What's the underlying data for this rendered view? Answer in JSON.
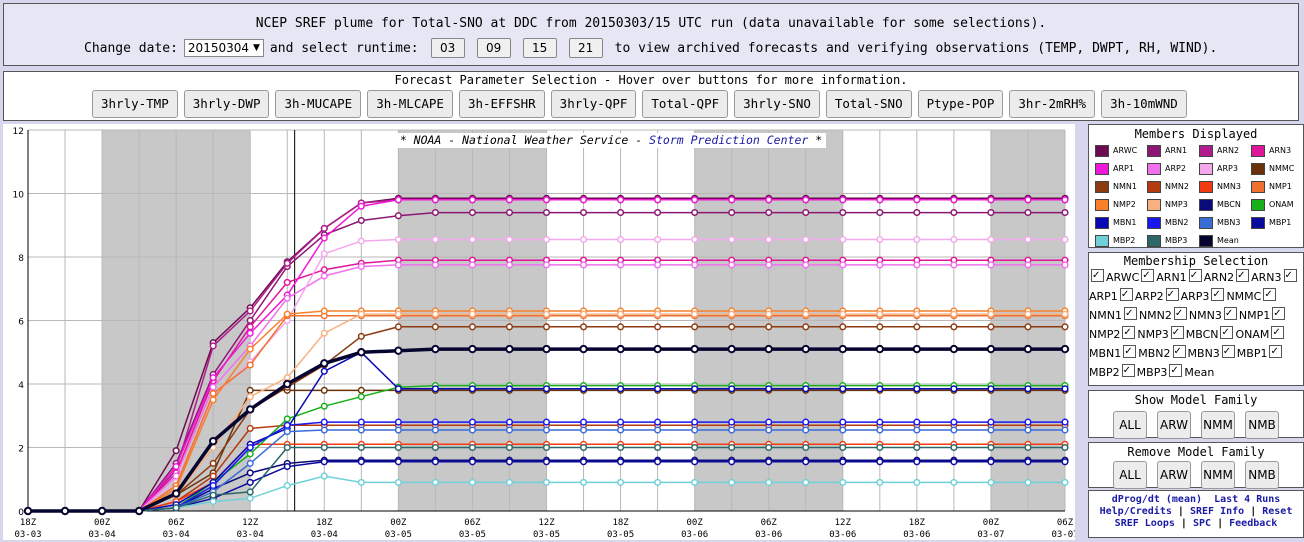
{
  "header": {
    "title": "NCEP SREF plume for Total-SNO at DDC from 20150303/15 UTC run (data unavailable for some selections).",
    "change_date_label": "Change date:",
    "date_value": "20150304",
    "select_runtime_label": "and select runtime:",
    "runtimes": [
      "03",
      "09",
      "15",
      "21"
    ],
    "after_text": "to view archived forecasts and verifying observations (TEMP, DWPT, RH, WIND)."
  },
  "params": {
    "title": "Forecast Parameter Selection - Hover over buttons for more information.",
    "buttons": [
      "3hrly-TMP",
      "3hrly-DWP",
      "3h-MUCAPE",
      "3h-MLCAPE",
      "3h-EFFSHR",
      "3hrly-QPF",
      "Total-QPF",
      "3hrly-SNO",
      "Total-SNO",
      "Ptype-POP",
      "3hr-2mRH%",
      "3h-10mWND"
    ]
  },
  "credit": {
    "prefix": "* NOAA - National Weather Service -",
    "link": "Storm Prediction Center",
    "suffix": "*"
  },
  "members": {
    "title": "Members Displayed",
    "items": [
      {
        "label": "ARWC",
        "color": "#6e0a4f"
      },
      {
        "label": "ARN1",
        "color": "#8c1674"
      },
      {
        "label": "ARN2",
        "color": "#b01c8c"
      },
      {
        "label": "ARN3",
        "color": "#e01698"
      },
      {
        "label": "ARP1",
        "color": "#f018d8"
      },
      {
        "label": "ARP2",
        "color": "#f070ee"
      },
      {
        "label": "ARP3",
        "color": "#f4a8ec"
      },
      {
        "label": "NMMC",
        "color": "#6a3208"
      },
      {
        "label": "NMN1",
        "color": "#8c3a10"
      },
      {
        "label": "NMN2",
        "color": "#b43a10"
      },
      {
        "label": "NMN3",
        "color": "#f03c10"
      },
      {
        "label": "NMP1",
        "color": "#f07030"
      },
      {
        "label": "NMP2",
        "color": "#f88028"
      },
      {
        "label": "NMP3",
        "color": "#f8b080"
      },
      {
        "label": "MBCN",
        "color": "#0a0a7a"
      },
      {
        "label": "ONAM",
        "color": "#18b018"
      },
      {
        "label": "MBN1",
        "color": "#0a0ab4"
      },
      {
        "label": "MBN2",
        "color": "#1818ee"
      },
      {
        "label": "MBN3",
        "color": "#3a6cd8"
      },
      {
        "label": "MBP1",
        "color": "#0a0a9e"
      },
      {
        "label": "MBP2",
        "color": "#70d0d8"
      },
      {
        "label": "MBP3",
        "color": "#2c6868"
      },
      {
        "label": "Mean",
        "color": "#050530"
      }
    ]
  },
  "membership": {
    "title": "Membership Selection",
    "rows": [
      [
        "ARWC",
        "ARN1",
        "ARN2",
        "ARN3"
      ],
      [
        "ARP1",
        "ARP2",
        "ARP3",
        "NMMC"
      ],
      [
        "NMN1",
        "NMN2",
        "NMN3",
        "NMP1"
      ],
      [
        "NMP2",
        "NMP3",
        "MBCN",
        "ONAM"
      ],
      [
        "MBN1",
        "MBN2",
        "MBN3",
        "MBP1"
      ],
      [
        "MBP2",
        "MBP3",
        "Mean"
      ]
    ]
  },
  "show_family": {
    "title": "Show Model Family",
    "buttons": [
      "ALL",
      "ARW",
      "NMM",
      "NMB"
    ]
  },
  "remove_family": {
    "title": "Remove Model Family",
    "buttons": [
      "ALL",
      "ARW",
      "NMM",
      "NMB"
    ]
  },
  "links": {
    "line1": "dProg/dt (mean)",
    "line1b": "Last 4 Runs",
    "line2a": "Help/Credits",
    "line2b": "SREF Info",
    "line2c": "Reset",
    "line3a": "SREF Loops",
    "line3b": "SPC",
    "line3c": "Feedback"
  },
  "chart_data": {
    "type": "line",
    "title": "",
    "xlabel": "",
    "ylabel": "",
    "ylim": [
      0,
      12
    ],
    "yticks": [
      0,
      2,
      4,
      6,
      8,
      10,
      12
    ],
    "grid": true,
    "x": [
      0,
      1,
      2,
      3,
      4,
      5,
      6,
      7,
      8,
      9,
      10,
      11,
      12,
      13,
      14,
      15,
      16,
      17,
      18,
      19,
      20,
      21,
      22,
      23,
      24,
      25,
      26,
      27,
      28
    ],
    "xtick_labels": [
      {
        "x": 0,
        "hour": "18Z",
        "date": "03-03"
      },
      {
        "x": 2,
        "hour": "00Z",
        "date": "03-04"
      },
      {
        "x": 4,
        "hour": "06Z",
        "date": "03-04"
      },
      {
        "x": 6,
        "hour": "12Z",
        "date": "03-04"
      },
      {
        "x": 8,
        "hour": "18Z",
        "date": "03-04"
      },
      {
        "x": 10,
        "hour": "00Z",
        "date": "03-05"
      },
      {
        "x": 12,
        "hour": "06Z",
        "date": "03-05"
      },
      {
        "x": 14,
        "hour": "12Z",
        "date": "03-05"
      },
      {
        "x": 16,
        "hour": "18Z",
        "date": "03-05"
      },
      {
        "x": 18,
        "hour": "00Z",
        "date": "03-06"
      },
      {
        "x": 20,
        "hour": "06Z",
        "date": "03-06"
      },
      {
        "x": 22,
        "hour": "12Z",
        "date": "03-06"
      },
      {
        "x": 24,
        "hour": "18Z",
        "date": "03-06"
      },
      {
        "x": 26,
        "hour": "00Z",
        "date": "03-07"
      },
      {
        "x": 28,
        "hour": "06Z",
        "date": "03-07"
      }
    ],
    "shaded_ranges": [
      [
        2,
        6
      ],
      [
        10,
        14
      ],
      [
        18,
        22
      ],
      [
        26,
        28
      ]
    ],
    "current_time_x": 7.2,
    "series": [
      {
        "name": "ARWC",
        "color": "#6e0a4f",
        "final": 9.85,
        "p": [
          0,
          0,
          0,
          0,
          1.9,
          5.3,
          6.4,
          7.85,
          8.9,
          9.7
        ]
      },
      {
        "name": "ARN1",
        "color": "#8c1674",
        "final": 9.4,
        "p": [
          0,
          0,
          0,
          0,
          1.5,
          4.3,
          6.0,
          7.7,
          8.7,
          9.15,
          9.3
        ]
      },
      {
        "name": "ARN2",
        "color": "#b01c8c",
        "final": 9.8,
        "p": [
          0,
          0,
          0,
          0,
          1.3,
          5.2,
          6.3,
          7.8,
          8.9,
          9.7
        ]
      },
      {
        "name": "ARN3",
        "color": "#e01698",
        "final": 7.9,
        "p": [
          0,
          0,
          0,
          0,
          1.2,
          4.1,
          5.8,
          7.2,
          7.6,
          7.8
        ]
      },
      {
        "name": "ARP1",
        "color": "#f018d8",
        "final": 9.8,
        "p": [
          0,
          0,
          0,
          0,
          1.4,
          4.2,
          5.6,
          6.8,
          8.6,
          9.6
        ]
      },
      {
        "name": "ARP2",
        "color": "#f070ee",
        "final": 7.75,
        "p": [
          0,
          0,
          0,
          0,
          1.1,
          3.9,
          5.2,
          6.7,
          7.4,
          7.7
        ]
      },
      {
        "name": "ARP3",
        "color": "#f4a8ec",
        "final": 8.55,
        "p": [
          0,
          0,
          0,
          0,
          0.9,
          3.6,
          4.7,
          6.0,
          8.1,
          8.5
        ]
      },
      {
        "name": "NMMC",
        "color": "#6a3208",
        "final": 3.8,
        "p": [
          0,
          0,
          0,
          0,
          0.5,
          1.2,
          3.8,
          3.8
        ]
      },
      {
        "name": "NMN1",
        "color": "#8c3a10",
        "final": 5.8,
        "p": [
          0,
          0,
          0,
          0,
          0.5,
          1.5,
          3.2,
          3.9,
          4.6,
          5.5
        ]
      },
      {
        "name": "NMN2",
        "color": "#b43a10",
        "final": 2.7,
        "p": [
          0,
          0,
          0,
          0,
          0.3,
          1.1,
          2.6
        ]
      },
      {
        "name": "NMN3",
        "color": "#f03c10",
        "final": 2.1,
        "p": [
          0,
          0,
          0,
          0,
          0.3,
          0.9,
          2.1
        ]
      },
      {
        "name": "NMP1",
        "color": "#f07030",
        "final": 6.15,
        "p": [
          0,
          0,
          0,
          0,
          0.8,
          3.7,
          4.6,
          6.15
        ]
      },
      {
        "name": "NMP2",
        "color": "#f88028",
        "final": 6.3,
        "p": [
          0,
          0,
          0,
          0,
          0.7,
          3.5,
          5.1,
          6.2
        ]
      },
      {
        "name": "NMP3",
        "color": "#f8b080",
        "final": 6.2,
        "p": [
          0,
          0,
          0,
          0,
          0.5,
          2.0,
          3.6,
          4.2,
          5.6,
          6.2
        ]
      },
      {
        "name": "MBCN",
        "color": "#0a0a7a",
        "final": 1.6,
        "p": [
          0,
          0,
          0,
          0,
          0.1,
          0.7,
          1.2,
          1.5
        ]
      },
      {
        "name": "ONAM",
        "color": "#18b018",
        "final": 3.95,
        "p": [
          0,
          0,
          0,
          0,
          0.1,
          0.9,
          1.8,
          2.9,
          3.3,
          3.6,
          3.9
        ]
      },
      {
        "name": "MBN1",
        "color": "#0a0ab4",
        "final": 3.85,
        "p": [
          0,
          0,
          0,
          0,
          0.2,
          0.9,
          2.1,
          2.6,
          4.4,
          5.0,
          3.85
        ]
      },
      {
        "name": "MBN2",
        "color": "#1818ee",
        "final": 2.8,
        "p": [
          0,
          0,
          0,
          0,
          0.1,
          0.8,
          2.0,
          2.7
        ]
      },
      {
        "name": "MBN3",
        "color": "#3a6cd8",
        "final": 2.55,
        "p": [
          0,
          0,
          0,
          0,
          0.1,
          0.6,
          1.5,
          2.5
        ]
      },
      {
        "name": "MBP1",
        "color": "#0a0a9e",
        "final": 1.55,
        "p": [
          0,
          0,
          0,
          0,
          0.1,
          0.4,
          0.9,
          1.4
        ]
      },
      {
        "name": "MBP2",
        "color": "#70d0d8",
        "final": 0.9,
        "p": [
          0,
          0,
          0,
          0,
          0.1,
          0.3,
          0.4,
          0.8,
          1.1
        ]
      },
      {
        "name": "MBP3",
        "color": "#2c6868",
        "final": 2.0,
        "p": [
          0,
          0,
          0,
          0,
          0.1,
          0.5,
          0.6,
          2.0
        ]
      },
      {
        "name": "Mean",
        "color": "#050530",
        "final": 5.1,
        "p": [
          0,
          0,
          0,
          0,
          0.55,
          2.2,
          3.2,
          4.0,
          4.65,
          5.0,
          5.05
        ]
      }
    ]
  }
}
